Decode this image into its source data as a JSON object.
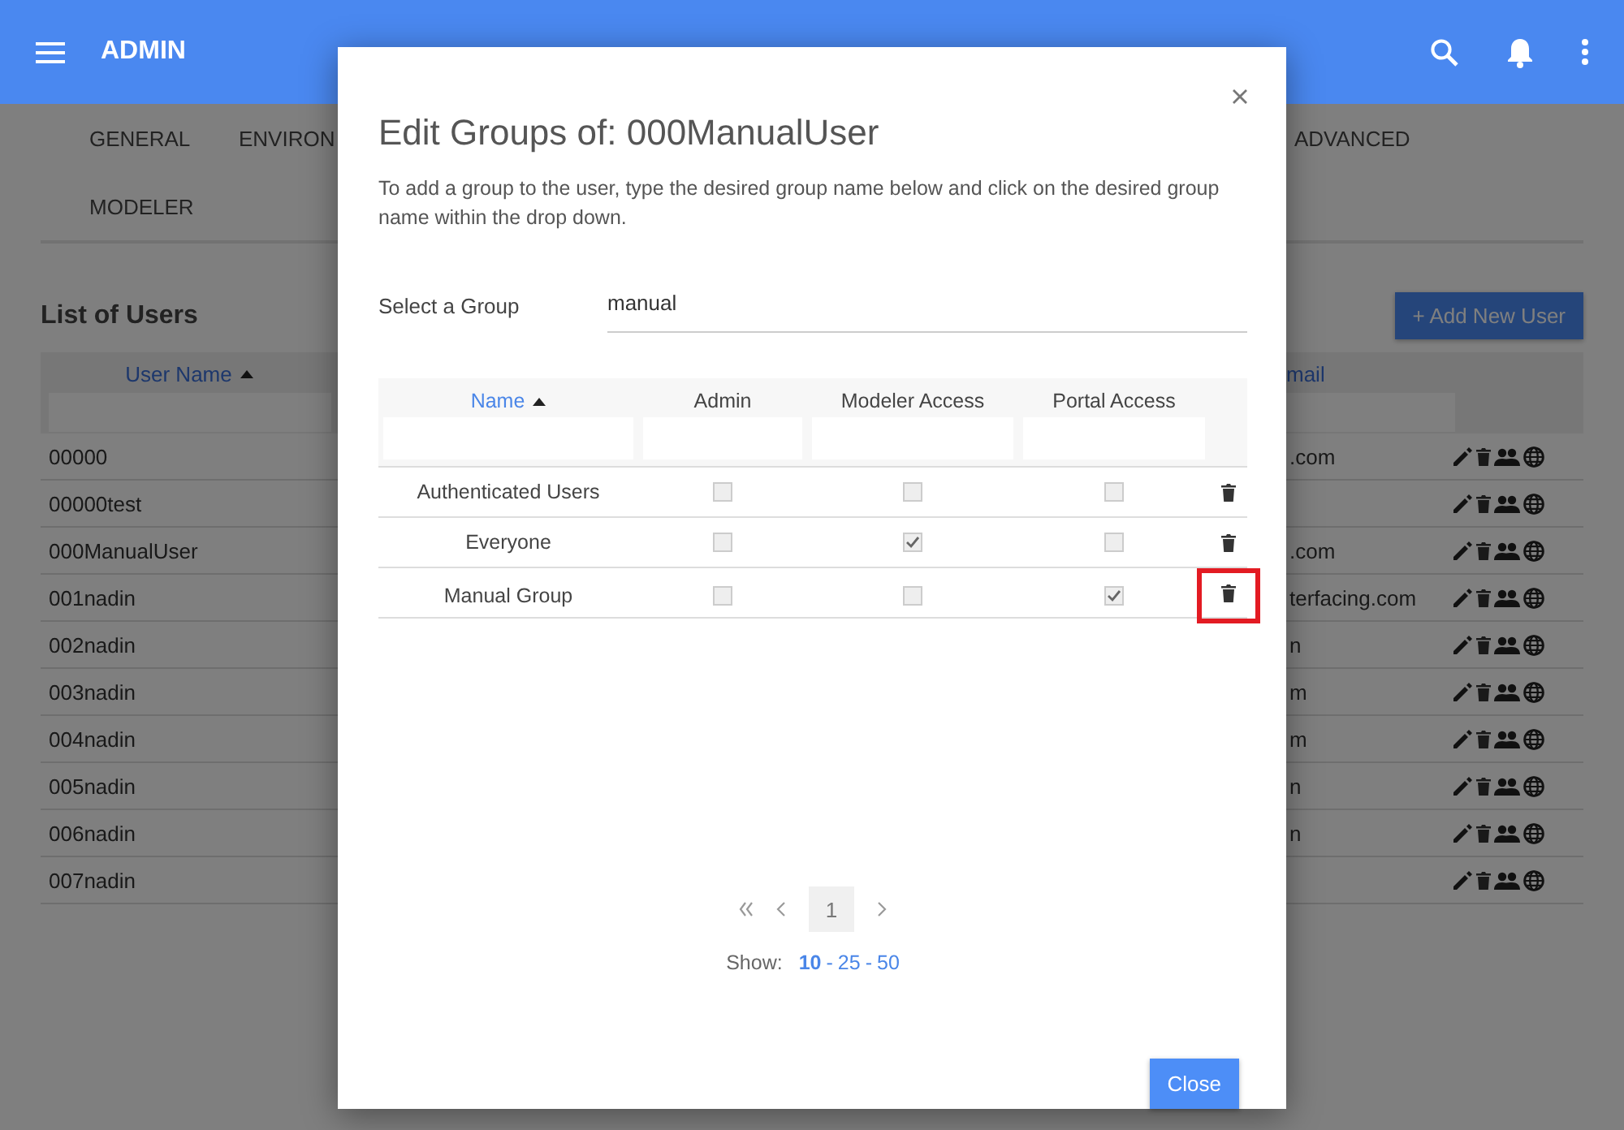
{
  "header": {
    "title": "ADMIN"
  },
  "tabs": [
    {
      "label": "GENERAL"
    },
    {
      "label": "ENVIRON"
    },
    {
      "label": "ADVANCED"
    },
    {
      "label": "MODELER"
    }
  ],
  "users": {
    "title": "List of Users",
    "add_button": "+ Add New User",
    "columns": [
      {
        "label": "User Name",
        "sorted": true
      },
      {
        "label": "mail",
        "sorted": false
      }
    ],
    "rows": [
      {
        "user_name": "00000",
        "email": ".com"
      },
      {
        "user_name": "00000test"
      },
      {
        "user_name": "000ManualUser",
        "email": ".com"
      },
      {
        "user_name": "001nadin",
        "email": "terfacing.com"
      },
      {
        "user_name": "002nadin",
        "email": "n"
      },
      {
        "user_name": "003nadin",
        "email": "m"
      },
      {
        "user_name": "004nadin",
        "email": "m"
      },
      {
        "user_name": "005nadin",
        "email": "n"
      },
      {
        "user_name": "006nadin",
        "email": "n"
      },
      {
        "user_name": "007nadin"
      }
    ]
  },
  "dialog": {
    "title": "Edit Groups of: 000ManualUser",
    "description": "To add a group to the user, type the desired group name below and click on the desired group name within the drop down.",
    "select_label": "Select a Group",
    "select_value": "manual",
    "columns": [
      {
        "label": "Name",
        "sorted": true
      },
      {
        "label": "Admin",
        "sorted": false
      },
      {
        "label": "Modeler Access",
        "sorted": false
      },
      {
        "label": "Portal Access",
        "sorted": false
      }
    ],
    "groups": [
      {
        "name": "Authenticated Users",
        "admin": false,
        "modeler_access": false,
        "portal_access": false,
        "highlighted": false
      },
      {
        "name": "Everyone",
        "admin": false,
        "modeler_access": true,
        "portal_access": false,
        "highlighted": false
      },
      {
        "name": "Manual Group",
        "admin": false,
        "modeler_access": false,
        "portal_access": true,
        "highlighted": true
      }
    ],
    "pages": [
      {
        "label": "1",
        "selected": true
      }
    ],
    "show_label": "Show:",
    "size_separator": "-",
    "page_sizes": [
      {
        "label": "10",
        "selected": true
      },
      {
        "label": "25",
        "selected": false
      },
      {
        "label": "50",
        "selected": false
      }
    ],
    "close_button": "Close"
  }
}
